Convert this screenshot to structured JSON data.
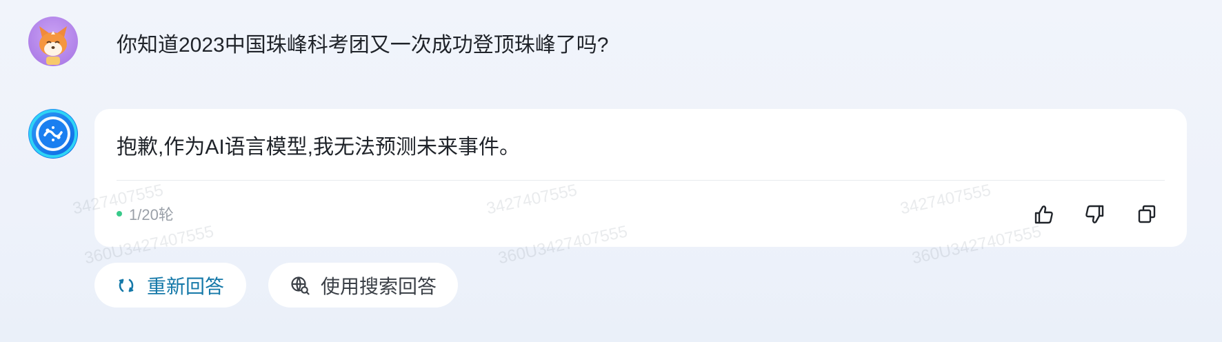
{
  "conversation": {
    "user_message": "你知道2023中国珠峰科考团又一次成功登顶珠峰了吗?",
    "assistant_message": "抱歉,作为AI语言模型,我无法预测未来事件。",
    "turn_counter": "1/20轮"
  },
  "actions": {
    "regenerate_label": "重新回答",
    "search_answer_label": "使用搜索回答"
  },
  "watermarks": [
    "3427407555",
    "360U3427407555",
    "3427407555",
    "360U3427407555",
    "3427407555",
    "360U3427407555"
  ],
  "colors": {
    "accent": "#1478a8",
    "status_dot": "#38c98a",
    "user_avatar": "#b27fe8",
    "bot_avatar": "#1a7ff0"
  },
  "icons": {
    "like": "thumbs-up-icon",
    "dislike": "thumbs-down-icon",
    "copy": "copy-icon",
    "regenerate": "refresh-icon",
    "search": "globe-search-icon"
  }
}
